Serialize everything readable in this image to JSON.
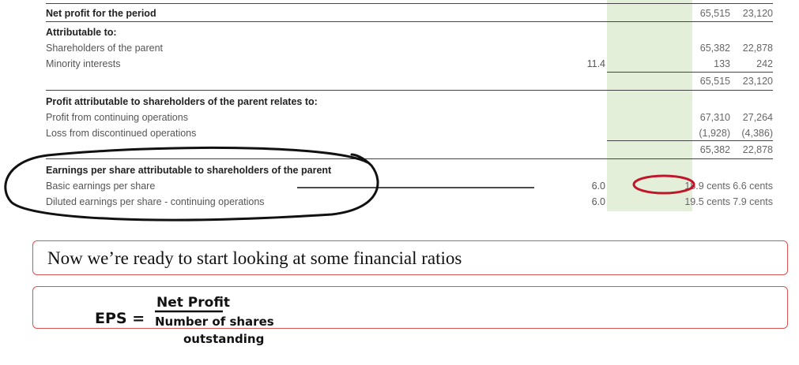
{
  "income_statement": {
    "net_profit": {
      "label": "Net profit for the period",
      "current": "65,515",
      "previous": "23,120"
    },
    "attributable_heading": "Attributable to:",
    "shareholders": {
      "label": "Shareholders of the parent",
      "current": "65,382",
      "previous": "22,878"
    },
    "minority": {
      "label": "Minority interests",
      "note": "11.4",
      "current": "133",
      "previous": "242"
    },
    "attributable_total": {
      "current": "65,515",
      "previous": "23,120"
    },
    "profit_relates_heading": "Profit attributable to shareholders of the parent relates to:",
    "continuing": {
      "label": "Profit from continuing operations",
      "current": "67,310",
      "previous": "27,264"
    },
    "discontinued": {
      "label": "Loss from discontinued operations",
      "current": "(1,928)",
      "previous": "(4,386)"
    },
    "relates_total": {
      "current": "65,382",
      "previous": "22,878"
    },
    "eps_heading": "Earnings per share attributable to shareholders of the parent",
    "basic_eps": {
      "label": "Basic earnings per share",
      "note": "6.0",
      "current": "18.9 cents",
      "previous": "6.6 cents"
    },
    "diluted_eps": {
      "label": "Diluted earnings per share - continuing operations",
      "note": "6.0",
      "current": "19.5 cents",
      "previous": "7.9 cents"
    }
  },
  "note_box_1": {
    "text": "Now we’re ready to start looking at some financial ratios"
  },
  "handwriting": {
    "lhs": "EPS =",
    "numerator": "Net Profit",
    "denominator_line1": "Number of shares",
    "denominator_line2": "outstanding"
  },
  "colors": {
    "highlight_column": "#e3efd9",
    "ink": "#111111",
    "red_circle": "#c0152a",
    "box_border": "#d9534f"
  }
}
